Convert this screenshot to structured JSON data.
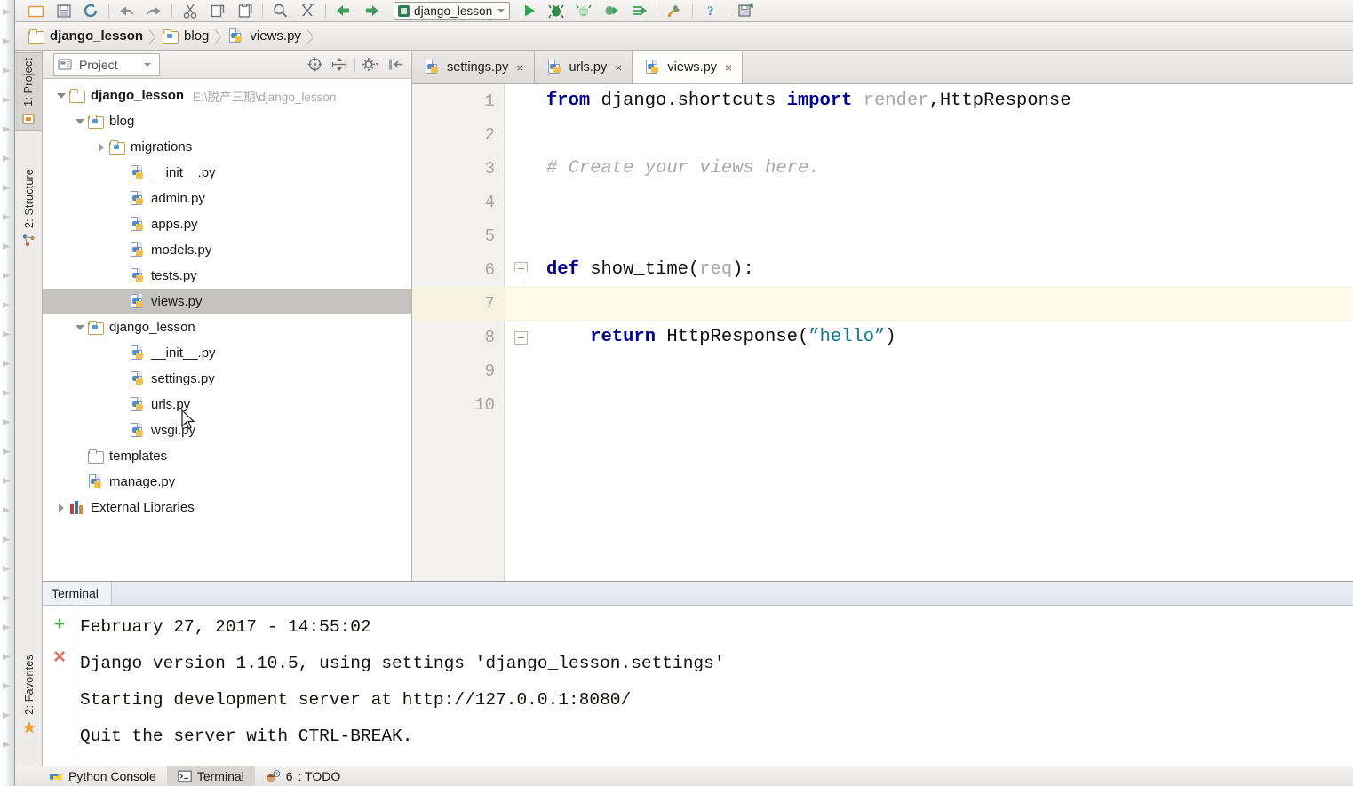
{
  "window": {
    "ide": "PyCharm",
    "run_config": "django_lesson"
  },
  "toolbar": {
    "buttons": [
      {
        "name": "open-icon",
        "label": "Open"
      },
      {
        "name": "save-all-icon",
        "label": "Save All"
      },
      {
        "name": "sync-icon",
        "label": "Synchronize"
      },
      {
        "name": "undo-icon",
        "label": "Undo"
      },
      {
        "name": "redo-icon",
        "label": "Redo"
      },
      {
        "name": "cut-icon",
        "label": "Cut"
      },
      {
        "name": "copy-icon",
        "label": "Copy"
      },
      {
        "name": "paste-icon",
        "label": "Paste"
      },
      {
        "name": "find-icon",
        "label": "Find"
      },
      {
        "name": "replace-icon",
        "label": "Replace"
      },
      {
        "name": "back-icon",
        "label": "Back"
      },
      {
        "name": "forward-icon",
        "label": "Forward"
      }
    ],
    "run_buttons": [
      {
        "name": "run-icon",
        "label": "Run"
      },
      {
        "name": "debug-icon",
        "label": "Debug"
      },
      {
        "name": "run-coverage-icon",
        "label": "Run with Coverage"
      },
      {
        "name": "profile-icon",
        "label": "Profile"
      },
      {
        "name": "attach-icon",
        "label": "Attach to Process"
      }
    ],
    "right_buttons": [
      {
        "name": "settings-wrench-icon",
        "label": "Settings"
      },
      {
        "name": "help-icon",
        "label": "Help"
      },
      {
        "name": "save-snapshot-icon",
        "label": "Save Snapshot"
      }
    ]
  },
  "breadcrumb": [
    {
      "label": "django_lesson",
      "icon": "folder-icon"
    },
    {
      "label": "blog",
      "icon": "module-folder-icon"
    },
    {
      "label": "views.py",
      "icon": "python-file-icon"
    }
  ],
  "stripe": {
    "left_top": [
      {
        "label": "1: Project",
        "icon": "project-icon",
        "active": true
      },
      {
        "label": "2: Structure",
        "icon": "structure-icon",
        "active": false
      }
    ],
    "left_bottom": [
      {
        "label": "2: Favorites",
        "icon": "star-icon",
        "active": false
      }
    ]
  },
  "project_panel": {
    "title": "Project",
    "tools": [
      {
        "name": "locate-target-icon",
        "label": "Scroll from Source"
      },
      {
        "name": "collapse-all-icon",
        "label": "Collapse All"
      },
      {
        "name": "gear-icon",
        "label": "Settings"
      },
      {
        "name": "hide-panel-icon",
        "label": "Hide"
      }
    ],
    "tree": [
      {
        "depth": 0,
        "label": "django_lesson",
        "path": "E:\\脱产三期\\django_lesson",
        "icon": "folder-icon",
        "twist": "open",
        "root": true,
        "selected": false
      },
      {
        "depth": 1,
        "label": "blog",
        "path": "",
        "icon": "module-folder-icon",
        "twist": "open",
        "root": false,
        "selected": false
      },
      {
        "depth": 2,
        "label": "migrations",
        "path": "",
        "icon": "module-folder-icon",
        "twist": "closed",
        "root": false,
        "selected": false
      },
      {
        "depth": 3,
        "label": "__init__.py",
        "path": "",
        "icon": "python-file-icon",
        "twist": "none",
        "root": false,
        "selected": false
      },
      {
        "depth": 3,
        "label": "admin.py",
        "path": "",
        "icon": "python-file-icon",
        "twist": "none",
        "root": false,
        "selected": false
      },
      {
        "depth": 3,
        "label": "apps.py",
        "path": "",
        "icon": "python-file-icon",
        "twist": "none",
        "root": false,
        "selected": false
      },
      {
        "depth": 3,
        "label": "models.py",
        "path": "",
        "icon": "python-file-icon",
        "twist": "none",
        "root": false,
        "selected": false
      },
      {
        "depth": 3,
        "label": "tests.py",
        "path": "",
        "icon": "python-file-icon",
        "twist": "none",
        "root": false,
        "selected": false
      },
      {
        "depth": 3,
        "label": "views.py",
        "path": "",
        "icon": "python-file-icon",
        "twist": "none",
        "root": false,
        "selected": true
      },
      {
        "depth": 1,
        "label": "django_lesson",
        "path": "",
        "icon": "module-folder-icon",
        "twist": "open",
        "root": false,
        "selected": false
      },
      {
        "depth": 3,
        "label": "__init__.py",
        "path": "",
        "icon": "python-file-icon",
        "twist": "none",
        "root": false,
        "selected": false
      },
      {
        "depth": 3,
        "label": "settings.py",
        "path": "",
        "icon": "python-file-icon",
        "twist": "none",
        "root": false,
        "selected": false
      },
      {
        "depth": 3,
        "label": "urls.py",
        "path": "",
        "icon": "python-file-icon",
        "twist": "none",
        "root": false,
        "selected": false
      },
      {
        "depth": 3,
        "label": "wsgi.py",
        "path": "",
        "icon": "python-file-icon",
        "twist": "none",
        "root": false,
        "selected": false
      },
      {
        "depth": 1,
        "label": "templates",
        "path": "",
        "icon": "plain-folder-icon",
        "twist": "none",
        "root": false,
        "selected": false
      },
      {
        "depth": 1,
        "label": "manage.py",
        "path": "",
        "icon": "python-file-icon",
        "twist": "none",
        "root": false,
        "selected": false
      },
      {
        "depth": 0,
        "label": "External Libraries",
        "path": "",
        "icon": "libraries-icon",
        "twist": "closed",
        "root": false,
        "selected": false
      }
    ]
  },
  "editor": {
    "tabs": [
      {
        "label": "settings.py",
        "icon": "python-file-icon",
        "active": false,
        "close": "×"
      },
      {
        "label": "urls.py",
        "icon": "python-file-icon",
        "active": false,
        "close": "×"
      },
      {
        "label": "views.py",
        "icon": "python-file-icon",
        "active": true,
        "close": "×"
      }
    ],
    "active_file": "views.py",
    "caret_line": 7,
    "line_numbers": [
      "1",
      "2",
      "3",
      "4",
      "5",
      "6",
      "7",
      "8",
      "9",
      "10"
    ],
    "lines": [
      {
        "n": 1,
        "tokens": [
          {
            "t": "from",
            "c": "kw"
          },
          {
            "t": " django.shortcuts ",
            "c": "plain"
          },
          {
            "t": "import",
            "c": "kw"
          },
          {
            "t": " ",
            "c": "plain"
          },
          {
            "t": "render",
            "c": "dim"
          },
          {
            "t": ",HttpResponse",
            "c": "plain"
          }
        ]
      },
      {
        "n": 2,
        "tokens": []
      },
      {
        "n": 3,
        "tokens": [
          {
            "t": "# Create your views here.",
            "c": "cmt"
          }
        ]
      },
      {
        "n": 4,
        "tokens": []
      },
      {
        "n": 5,
        "tokens": []
      },
      {
        "n": 6,
        "tokens": [
          {
            "t": "def",
            "c": "kw"
          },
          {
            "t": " show_time(",
            "c": "fname"
          },
          {
            "t": "req",
            "c": "dim"
          },
          {
            "t": "):",
            "c": "plain"
          }
        ]
      },
      {
        "n": 7,
        "tokens": []
      },
      {
        "n": 8,
        "tokens": [
          {
            "t": "    ",
            "c": "plain"
          },
          {
            "t": "return",
            "c": "kw"
          },
          {
            "t": " HttpResponse(",
            "c": "plain"
          },
          {
            "t": "”hello”",
            "c": "str"
          },
          {
            "t": ")",
            "c": "plain"
          }
        ]
      },
      {
        "n": 9,
        "tokens": []
      },
      {
        "n": 10,
        "tokens": []
      }
    ]
  },
  "terminal": {
    "tab_label": "Terminal",
    "rail": [
      {
        "name": "new-session-icon",
        "glyph": "+"
      },
      {
        "name": "close-session-icon",
        "glyph": "×"
      }
    ],
    "output": [
      "February 27, 2017 - 14:55:02",
      "Django version 1.10.5, using settings 'django_lesson.settings'",
      "Starting development server at http://127.0.0.1:8080/",
      "Quit the server with CTRL-BREAK."
    ]
  },
  "statusbar": {
    "items": [
      {
        "label": "Python Console",
        "icon": "python-console-icon",
        "active": false,
        "prefix": ""
      },
      {
        "label": "Terminal",
        "icon": "terminal-icon",
        "active": true,
        "prefix": ""
      },
      {
        "label": ": TODO",
        "icon": "todo-icon",
        "active": false,
        "prefix": "6"
      }
    ]
  },
  "colors": {
    "keyword": "#00008F",
    "string": "#0B7A8C",
    "comment": "#A9A9A9",
    "caret_row": "#FFFBE8",
    "selection": "#C5C3C0",
    "run_green": "#49B04B"
  }
}
